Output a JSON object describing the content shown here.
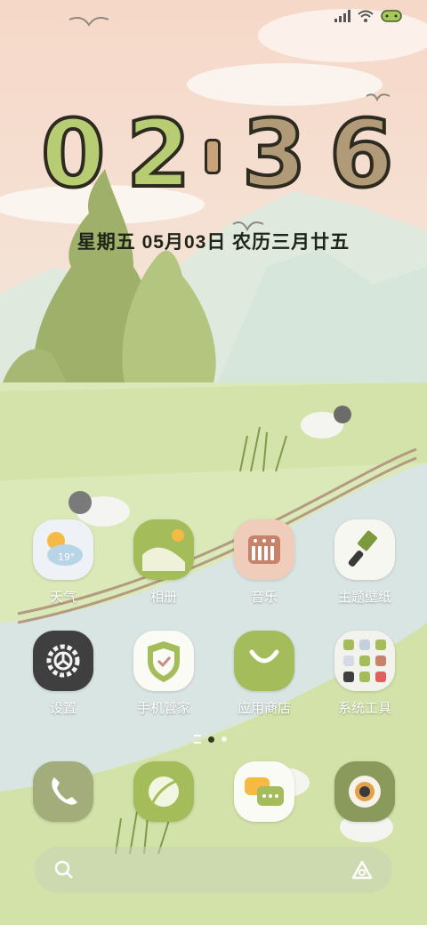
{
  "status_bar": {
    "signal_icon": "signal-icon",
    "wifi_icon": "wifi-icon",
    "battery_icon": "battery-icon"
  },
  "clock": {
    "h1": "0",
    "h2": "2",
    "m1": "3",
    "m2": "6",
    "hour_color": "#b8cc73",
    "minute_color": "#b09a78",
    "separator_color": "#c9a27a"
  },
  "date": {
    "text": "星期五  05月03日  农历三月廿五"
  },
  "apps": [
    {
      "label": "天气",
      "icon": "weather-icon",
      "temp": "19°"
    },
    {
      "label": "相册",
      "icon": "gallery-icon"
    },
    {
      "label": "音乐",
      "icon": "music-icon"
    },
    {
      "label": "主题壁纸",
      "icon": "theme-brush-icon"
    },
    {
      "label": "设置",
      "icon": "settings-gear-icon"
    },
    {
      "label": "手机管家",
      "icon": "shield-check-icon"
    },
    {
      "label": "应用商店",
      "icon": "app-store-icon"
    },
    {
      "label": "系统工具",
      "icon": "tools-folder-icon"
    }
  ],
  "page_indicator": {
    "pages": 3,
    "current": 2
  },
  "dock": [
    {
      "icon": "phone-icon"
    },
    {
      "icon": "browser-icon"
    },
    {
      "icon": "messages-icon"
    },
    {
      "icon": "camera-icon"
    }
  ],
  "search": {
    "icon": "search-icon",
    "assistant_icon": "assistant-icon"
  },
  "colors": {
    "accent_green": "#a4bd5a",
    "sky": "#f5ddd0",
    "river": "#d8e4e4"
  }
}
